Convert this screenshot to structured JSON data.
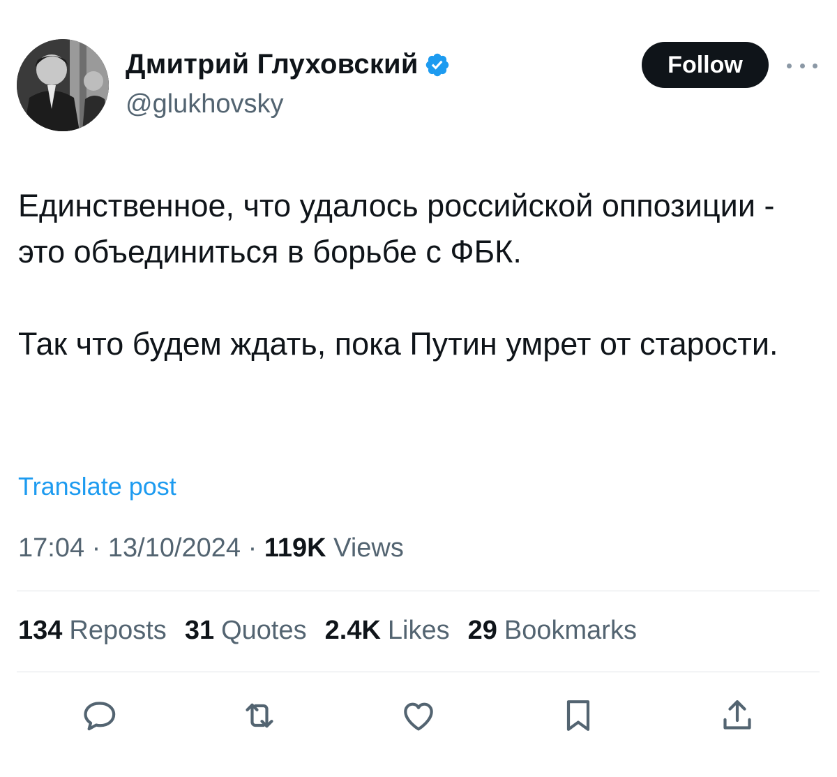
{
  "author": {
    "display_name": "Дмитрий Глуховский",
    "handle": "@glukhovsky",
    "verified_color": "#1d9bf0"
  },
  "header": {
    "follow_label": "Follow",
    "more_icon": "more-horizontal-icon"
  },
  "post": {
    "paragraphs": [
      "Единственное, что удалось российской оппозиции - это объединиться в борьбе с ФБК.",
      "Так что будем ждать, пока Путин умрет от старости."
    ],
    "translate_label": "Translate post"
  },
  "meta": {
    "time": "17:04",
    "date": "13/10/2024",
    "views_count": "119K",
    "views_label": "Views",
    "separator": "·"
  },
  "stats": {
    "reposts_count": "134",
    "reposts_label": "Reposts",
    "quotes_count": "31",
    "quotes_label": "Quotes",
    "likes_count": "2.4K",
    "likes_label": "Likes",
    "bookmarks_count": "29",
    "bookmarks_label": "Bookmarks"
  },
  "actions": [
    {
      "icon": "reply-icon"
    },
    {
      "icon": "repost-icon"
    },
    {
      "icon": "like-icon"
    },
    {
      "icon": "bookmark-icon"
    },
    {
      "icon": "share-icon"
    }
  ],
  "colors": {
    "text_primary": "#0f1419",
    "text_secondary": "#536471",
    "link": "#1d9bf0",
    "button_bg": "#0f1419",
    "icon_gray": "#536471"
  }
}
